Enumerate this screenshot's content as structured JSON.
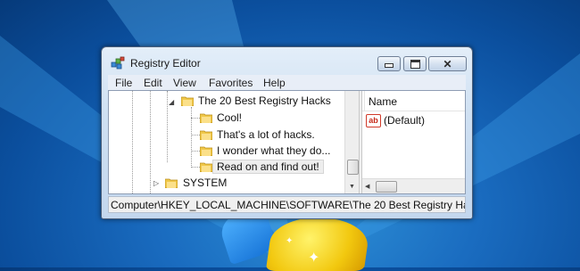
{
  "window": {
    "title": "Registry Editor",
    "icon": "registry-editor-icon"
  },
  "menu": [
    "File",
    "Edit",
    "View",
    "Favorites",
    "Help"
  ],
  "tree": {
    "parent": {
      "label": "The 20 Best Registry Hacks",
      "expanded": true
    },
    "children": [
      {
        "label": "Cool!"
      },
      {
        "label": "That's a lot of hacks."
      },
      {
        "label": "I wonder what they do..."
      },
      {
        "label": "Read on and find out!",
        "selected": true
      }
    ],
    "sibling": {
      "label": "SYSTEM",
      "expanded": false
    }
  },
  "list": {
    "column_header": "Name",
    "rows": [
      {
        "name": "(Default)",
        "icon": "string-value-icon"
      }
    ]
  },
  "statusbar": {
    "path": "Computer\\HKEY_LOCAL_MACHINE\\SOFTWARE\\The 20 Best Registry Ha"
  },
  "colors": {
    "desktop": "#1a6cc0",
    "folder": "#f0c84a",
    "accent_red": "#d13a2a"
  }
}
